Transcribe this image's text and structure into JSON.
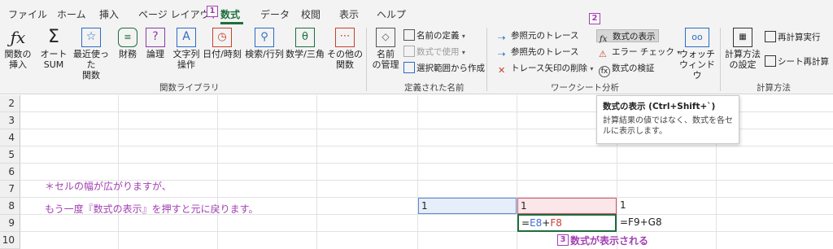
{
  "tabs": [
    {
      "label": "ファイル"
    },
    {
      "label": "ホーム"
    },
    {
      "label": "挿入"
    },
    {
      "label": "ページ レイアウト"
    },
    {
      "label": "数式"
    },
    {
      "label": "データ"
    },
    {
      "label": "校閲"
    },
    {
      "label": "表示"
    },
    {
      "label": "ヘルプ"
    }
  ],
  "markers": {
    "m1": "1",
    "m2": "2",
    "m3": "3"
  },
  "ribbon": {
    "function_library": {
      "insert_function": "関数の\n挿入",
      "autosum": "オート\nSUM",
      "recent": "最近使った\n関数",
      "financial": "財務",
      "logical": "論理",
      "text": "文字列\n操作",
      "datetime": "日付/時刻",
      "lookup": "検索/行列",
      "math": "数学/三角",
      "more": "その他の\n関数",
      "label": "関数ライブラリ"
    },
    "defined_names": {
      "name_manager": "名前\nの管理",
      "define_name": "名前の定義",
      "use_in_formula": "数式で使用",
      "create_from_selection": "選択範囲から作成",
      "label": "定義された名前"
    },
    "formula_auditing": {
      "trace_precedents": "参照元のトレース",
      "trace_dependents": "参照先のトレース",
      "remove_arrows": "トレース矢印の削除",
      "show_formulas": "数式の表示",
      "error_checking": "エラー チェック",
      "evaluate_formula": "数式の検証",
      "watch_window": "ウォッチ\nウィンドウ",
      "label": "ワークシート分析"
    },
    "calculation": {
      "calc_options": "計算方法\nの設定",
      "calc_now": "再計算実行",
      "calc_sheet": "シート再計算",
      "label": "計算方法"
    }
  },
  "tooltip": {
    "title": "数式の表示 (Ctrl+Shift+`)",
    "body": "計算結果の値ではなく、数式を各セルに表示します。"
  },
  "sheet": {
    "row_numbers": [
      "2",
      "3",
      "4",
      "5",
      "6",
      "7",
      "8",
      "9",
      "10"
    ],
    "note_line1": "＊セルの幅が広がりますが、",
    "note_line2": "もう一度『数式の表示』を押すと元に戻ります。",
    "e8": "1",
    "f8": "1",
    "g8": "1",
    "f9_eq": "=",
    "f9_ref1": "E8",
    "f9_plus": "+",
    "f9_ref2": "F8",
    "g9": "=F9+G8",
    "caption": "数式が表示される"
  },
  "colors": {
    "accent": "#1e6e3c",
    "annotation": "#a23fb3",
    "ref_blue": "#3a6fd0",
    "ref_red": "#d03a3a"
  }
}
